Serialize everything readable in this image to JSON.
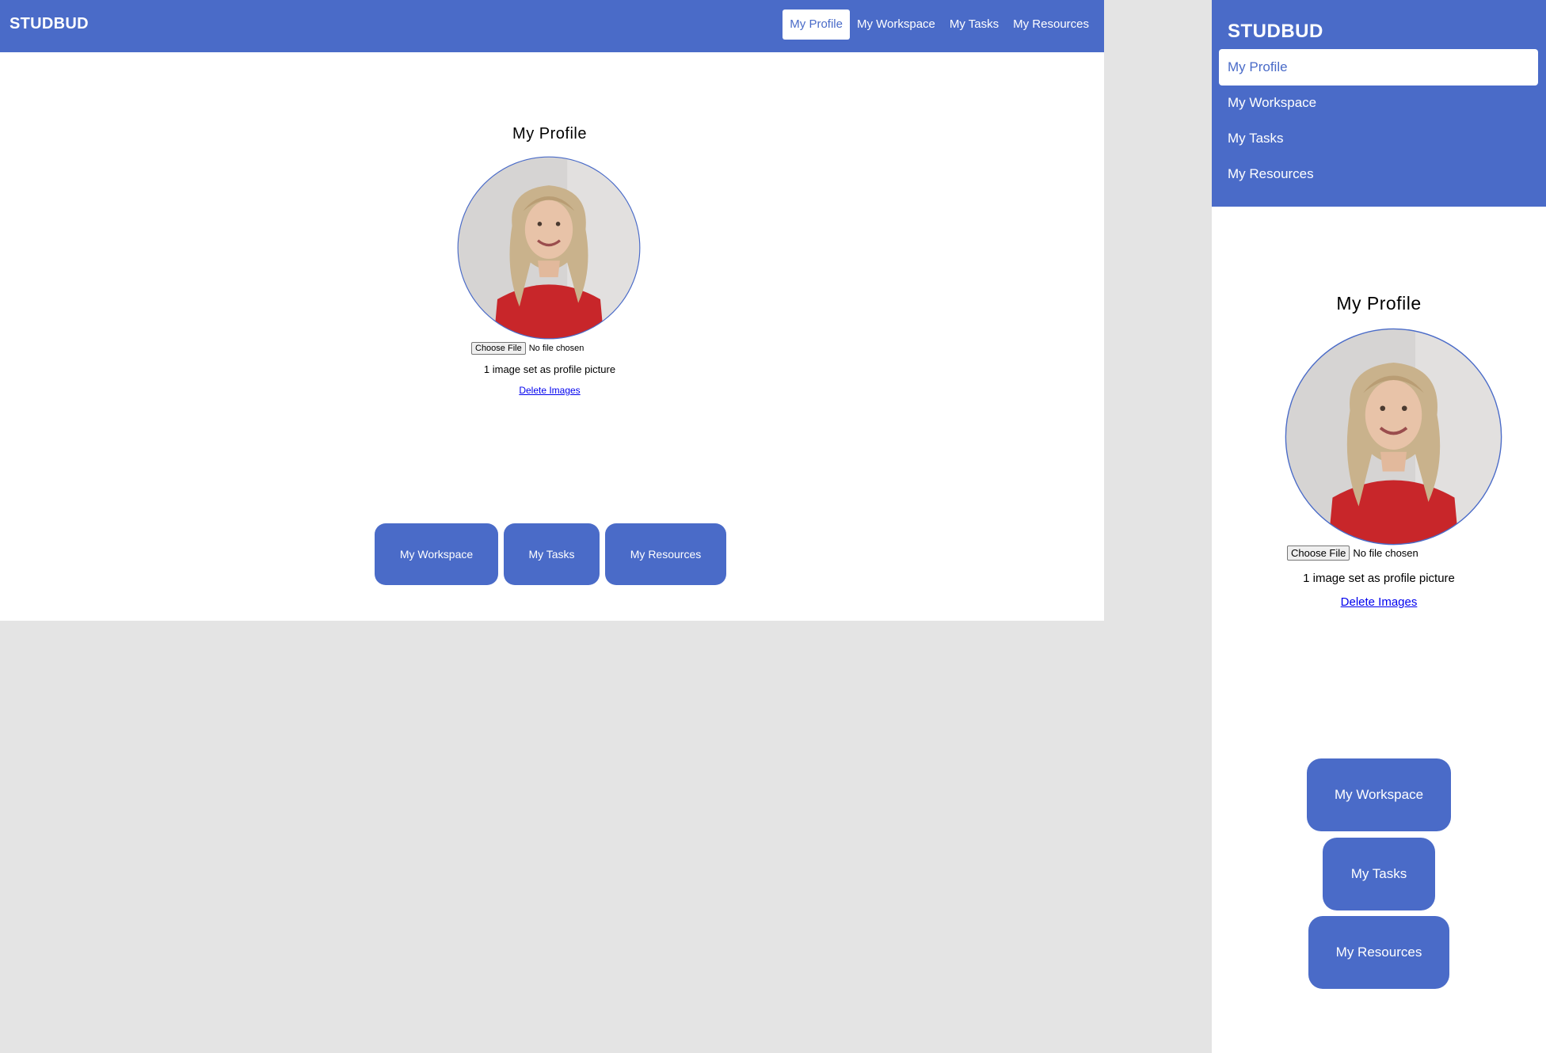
{
  "brand": "STUDBUD",
  "nav": {
    "items": [
      {
        "label": "My Profile",
        "active": true
      },
      {
        "label": "My Workspace",
        "active": false
      },
      {
        "label": "My Tasks",
        "active": false
      },
      {
        "label": "My Resources",
        "active": false
      }
    ]
  },
  "profile": {
    "title": "My Profile",
    "file_button": "Choose File",
    "file_status": "No file chosen",
    "image_status": "1 image set as profile picture",
    "delete_link": "Delete Images"
  },
  "cards": [
    {
      "label": "My Workspace"
    },
    {
      "label": "My Tasks"
    },
    {
      "label": "My Resources"
    }
  ],
  "colors": {
    "accent": "#4a6bc8",
    "page_bg": "#e4e4e4",
    "link": "#0000ee"
  }
}
